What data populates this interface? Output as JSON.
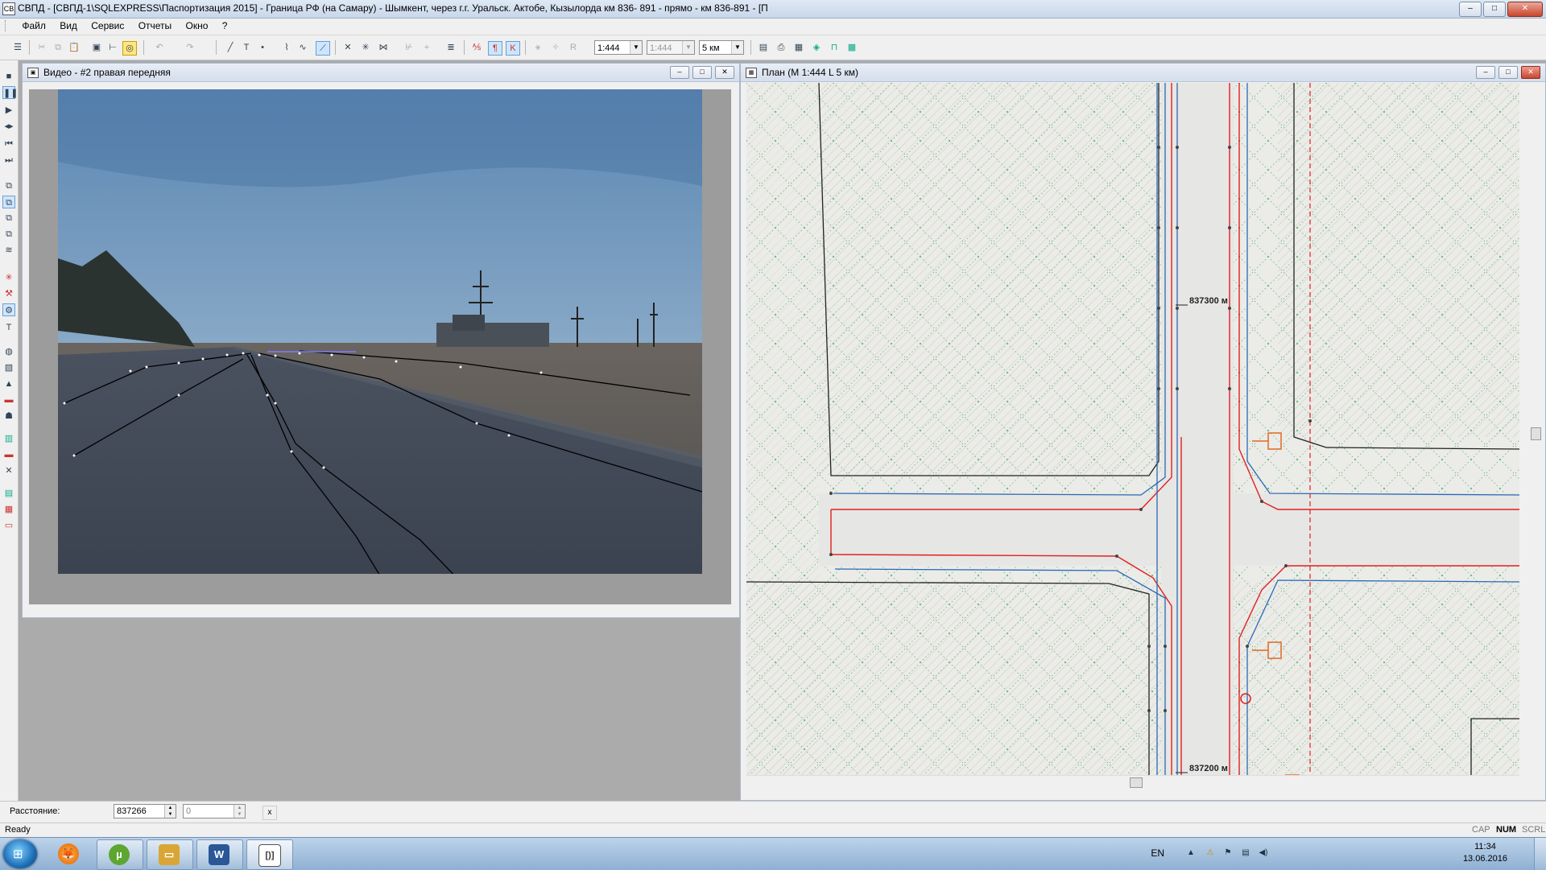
{
  "app": {
    "title": "СВПД - [СВПД-1\\SQLEXPRESS\\Паспортизация 2015] - Граница РФ (на Самару) - Шымкент, через г.г. Уральск. Актобе, Кызылорда км  836- 891  - прямо - км 836-891 -  [П",
    "icon_label": "СВ",
    "min": "–",
    "max": "□",
    "close": "✕"
  },
  "menu": [
    "Файл",
    "Вид",
    "Сервис",
    "Отчеты",
    "Окно",
    "?"
  ],
  "toolbar": {
    "scale_value": "1:444",
    "scale2_value": "1:444",
    "length_value": "5 км"
  },
  "video_window": {
    "title": "Видео -  #2 правая передняя",
    "icon": "video-camera-icon"
  },
  "plan_window": {
    "title": "План (М 1:444  L 5 км)",
    "icon": "plan-map-icon",
    "label_top": "837300 м",
    "label_bottom": "837200 м"
  },
  "distance_bar": {
    "label": "Расстояние:",
    "value": "837266",
    "value2": "0",
    "close": "x"
  },
  "status": {
    "ready": "Ready",
    "cap": "CAP",
    "num": "NUM",
    "scrl": "SCRL"
  },
  "taskbar": {
    "lang": "EN",
    "time": "11:34",
    "date": "13.06.2016",
    "apps": [
      {
        "name": "firefox",
        "glyph": "🦊",
        "color": "#e66000"
      },
      {
        "name": "utorrent",
        "glyph": "µ",
        "color": "#5ea632"
      },
      {
        "name": "explorer",
        "glyph": "▭",
        "color": "#d9a636"
      },
      {
        "name": "word",
        "glyph": "W",
        "color": "#2b5797"
      },
      {
        "name": "svpd",
        "glyph": "[)]",
        "color": "#333"
      }
    ]
  },
  "colors": {
    "red_line": "#e02020",
    "blue_line": "#2a6ab5",
    "orange_sign": "#e06a20",
    "green_hatch": "#2fa54a"
  }
}
